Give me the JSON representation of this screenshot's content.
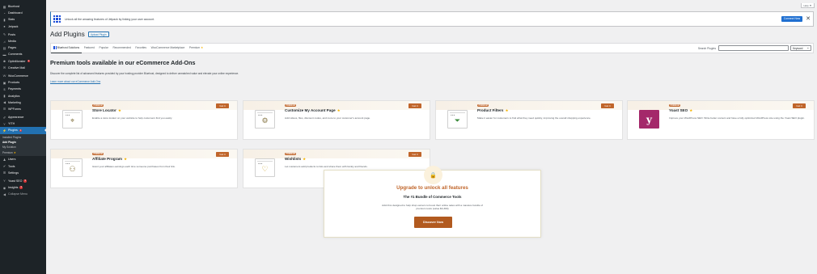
{
  "sidebar": {
    "items": [
      {
        "label": "Bluehost",
        "icon": "grid-icon"
      },
      {
        "label": "Dashboard",
        "icon": "dashboard-icon"
      },
      {
        "label": "Stats",
        "icon": "stats-icon"
      },
      {
        "label": "Jetpack",
        "icon": "jetpack-icon"
      },
      {
        "label": "Posts",
        "icon": "pin-icon"
      },
      {
        "label": "Media",
        "icon": "media-icon"
      },
      {
        "label": "Pages",
        "icon": "page-icon"
      },
      {
        "label": "Comments",
        "icon": "comments-icon"
      },
      {
        "label": "OptinMonster",
        "icon": "optinmonster-icon",
        "badge": "1"
      },
      {
        "label": "Creative Mail",
        "icon": "mail-icon"
      },
      {
        "label": "WooCommerce",
        "icon": "woo-icon"
      },
      {
        "label": "Products",
        "icon": "products-icon"
      },
      {
        "label": "Payments",
        "icon": "payments-icon"
      },
      {
        "label": "Analytics",
        "icon": "analytics-icon"
      },
      {
        "label": "Marketing",
        "icon": "marketing-icon"
      },
      {
        "label": "WPForms",
        "icon": "forms-icon"
      },
      {
        "label": "Appearance",
        "icon": "appearance-icon"
      },
      {
        "label": "YITH",
        "icon": "yith-icon"
      },
      {
        "label": "Plugins",
        "icon": "plugins-icon",
        "badge": "1"
      },
      {
        "label": "Users",
        "icon": "users-icon"
      },
      {
        "label": "Tools",
        "icon": "tools-icon"
      },
      {
        "label": "Settings",
        "icon": "settings-icon"
      },
      {
        "label": "Yoast SEO",
        "icon": "yoast-icon",
        "badge": "3"
      },
      {
        "label": "Insights",
        "icon": "insights-icon",
        "badge": "3"
      },
      {
        "label": "Collapse Menu",
        "icon": "collapse-icon"
      }
    ],
    "plugins_submenu": [
      {
        "label": "Installed Plugins"
      },
      {
        "label": "Add Plugin"
      },
      {
        "label": "My Solution"
      },
      {
        "label": "Premium"
      }
    ]
  },
  "help_tab": "Help ▼",
  "notice": {
    "text": "Unlock all the amazing features of Jetpack by linking your user account.",
    "button": "Connect Now",
    "close": "✕"
  },
  "page": {
    "title": "Add Plugins",
    "upload_button": "Upload Plugin"
  },
  "filter_tabs": [
    "Bluehost Solutions",
    "Featured",
    "Popular",
    "Recommended",
    "Favorites",
    "WooCommerce Marketplace",
    "Premium"
  ],
  "search": {
    "label": "Search Plugins",
    "value": "",
    "type_select": "Keyword"
  },
  "section": {
    "title": "Premium tools available in our eCommerce Add-Ons",
    "description": "Discover the complete list of advanced features provided by your hosting provider Bluehost, designed to deliver unmatched value and elevate your online experience.",
    "link": "Learn more about our eCommerce Add-Ons"
  },
  "cards": [
    {
      "badge": "PREMIUM",
      "title": "Store Locator",
      "desc": "Enable a store locator on your website to help customers find you easily.",
      "button": "Get it",
      "icon": "store-locator-icon"
    },
    {
      "badge": "PREMIUM",
      "title": "Customize My Account Page",
      "desc": "Add videos, files, discount codes, and more to your customer's account page.",
      "button": "Get it",
      "icon": "account-page-icon"
    },
    {
      "badge": "PREMIUM",
      "title": "Product Filters",
      "desc": "Make it easier for customers to find what they need quickly, improving the overall shopping experience.",
      "button": "Get it",
      "icon": "filter-icon"
    },
    {
      "badge": "PREMIUM",
      "title": "Yoast SEO",
      "desc": "Improve your WordPress SEO: Write better content and have a fully optimized WordPress site using the Yoast SEO plugin.",
      "button": "Get it",
      "icon": "yoast-logo-icon"
    },
    {
      "badge": "PREMIUM",
      "title": "Affiliate Program",
      "desc": "Grant your affiliates earnings each time someone purchases from their link.",
      "button": "Get it",
      "icon": "affiliate-icon"
    },
    {
      "badge": "PREMIUM",
      "title": "Wishlists",
      "desc": "Let customers add products to lists and share them with family and friends.",
      "button": "Get it",
      "icon": "wishlist-icon"
    }
  ],
  "upgrade": {
    "title": "Upgrade to unlock all features",
    "subtitle": "The #1 Bundle of Commerce Tools",
    "desc": "Add-Ons designed to help shop owners to boost their online sales with a massive bundle of premium tools (value $3,300)",
    "button": "Discover Now"
  },
  "colors": {
    "sidebar_bg": "#1d2327",
    "accent_blue": "#2271b1",
    "premium_orange": "#c0652a",
    "badge_red": "#d63638"
  }
}
